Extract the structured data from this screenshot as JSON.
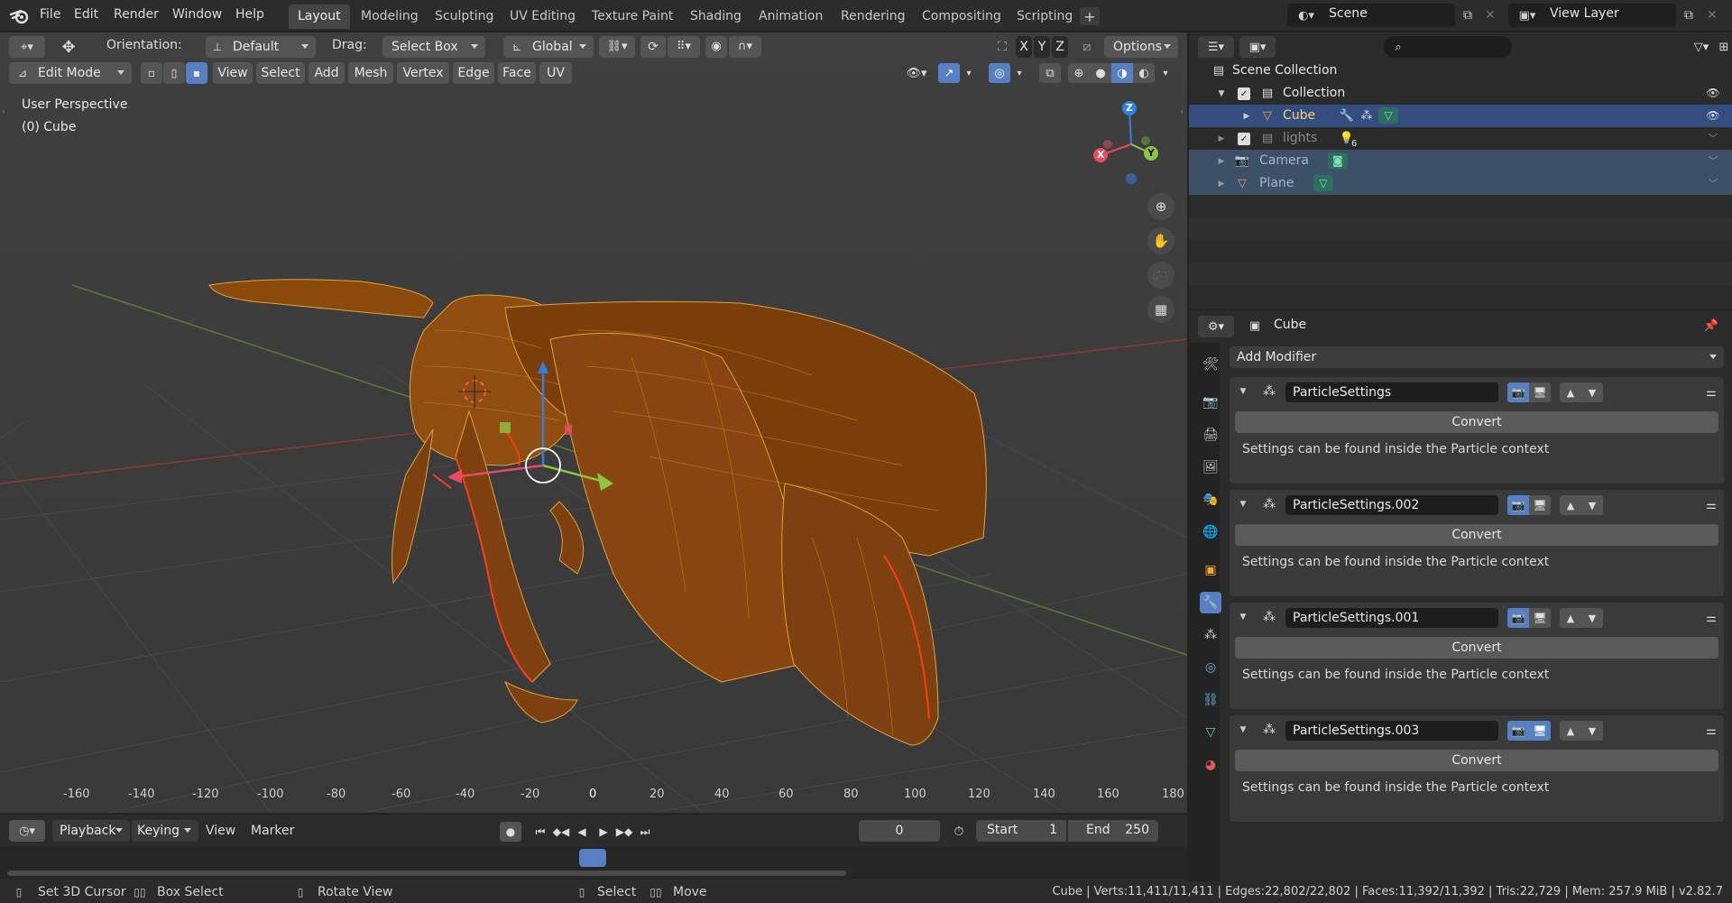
{
  "app": {
    "logo_icon": "blender-logo-icon"
  },
  "menu": [
    "File",
    "Edit",
    "Render",
    "Window",
    "Help"
  ],
  "workspaces": [
    "Layout",
    "Modeling",
    "Sculpting",
    "UV Editing",
    "Texture Paint",
    "Shading",
    "Animation",
    "Rendering",
    "Compositing",
    "Scripting"
  ],
  "active_workspace": "Layout",
  "scene": {
    "label": "Scene",
    "view_layer": "View Layer"
  },
  "tool_header": {
    "orientation_label": "Orientation:",
    "orientation_value": "Default",
    "drag_label": "Drag:",
    "drag_value": "Select Box",
    "transform_orientation": "Global",
    "axis_x": "X",
    "axis_y": "Y",
    "axis_z": "Z",
    "options_label": "Options"
  },
  "viewport_header": {
    "mode": "Edit Mode",
    "menus": [
      "View",
      "Select",
      "Add",
      "Mesh",
      "Vertex",
      "Edge",
      "Face",
      "UV"
    ]
  },
  "viewport": {
    "perspective_label": "User Perspective",
    "object_label": "(0) Cube",
    "gizmo": {
      "x": "X",
      "y": "Y",
      "z": "Z"
    }
  },
  "timeline": {
    "menus": [
      "Playback",
      "Keying",
      "View",
      "Marker"
    ],
    "current_frame": "0",
    "start_label": "Start",
    "start_value": "1",
    "end_label": "End",
    "end_value": "250",
    "ticks": [
      "-160",
      "-140",
      "-120",
      "-100",
      "-80",
      "-60",
      "-40",
      "-20",
      "0",
      "20",
      "40",
      "60",
      "80",
      "100",
      "120",
      "140",
      "160",
      "180"
    ]
  },
  "outliner": {
    "root": "Scene Collection",
    "items": [
      {
        "label": "Collection",
        "badge": ""
      },
      {
        "label": "Cube",
        "badge": ""
      },
      {
        "label": "lights",
        "badge": "6"
      },
      {
        "label": "Camera",
        "badge": ""
      },
      {
        "label": "Plane",
        "badge": ""
      }
    ]
  },
  "properties": {
    "object_name": "Cube",
    "add_modifier": "Add Modifier",
    "modifiers": [
      {
        "name": "ParticleSettings",
        "convert": "Convert",
        "note": "Settings can be found inside the Particle context"
      },
      {
        "name": "ParticleSettings.002",
        "convert": "Convert",
        "note": "Settings can be found inside the Particle context"
      },
      {
        "name": "ParticleSettings.001",
        "convert": "Convert",
        "note": "Settings can be found inside the Particle context"
      },
      {
        "name": "ParticleSettings.003",
        "convert": "Convert",
        "note": "Settings can be found inside the Particle context"
      }
    ]
  },
  "status": {
    "hints": [
      "Set 3D Cursor",
      "Box Select",
      "Rotate View",
      "Select",
      "Move"
    ],
    "stats": "Cube | Verts:11,411/11,411 | Edges:22,802/22,802 | Faces:11,392/11,392 | Tris:22,729 | Mem: 257.9 MiB | v2.82.7"
  },
  "colors": {
    "accent": "#5680c2",
    "selection": "#f5a623",
    "edge_select": "#ff3b1a",
    "axis_x": "#e84a5f",
    "axis_y": "#8cc63f",
    "axis_z": "#2f7fe0"
  }
}
